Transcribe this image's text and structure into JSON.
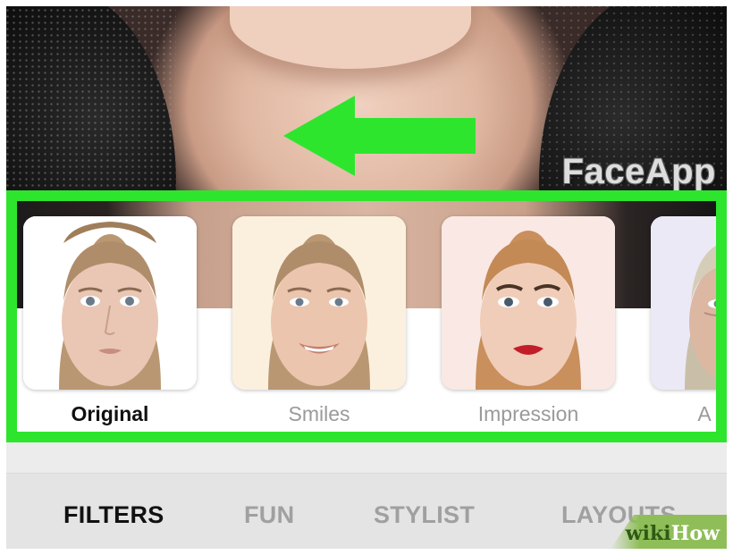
{
  "app": {
    "brand": "FaceApp"
  },
  "filters": [
    {
      "label": "Original",
      "active": true
    },
    {
      "label": "Smiles",
      "active": false
    },
    {
      "label": "Impression",
      "active": false
    },
    {
      "label": "A",
      "active": false
    }
  ],
  "tabs": [
    {
      "label": "FILTERS",
      "active": true
    },
    {
      "label": "FUN",
      "active": false
    },
    {
      "label": "STYLIST",
      "active": false
    },
    {
      "label": "LAYOUTS",
      "active": false
    }
  ],
  "watermark": {
    "part1": "wiki",
    "part2": "How"
  },
  "colors": {
    "highlight": "#2ee52e",
    "arrow": "#2ee52e"
  }
}
